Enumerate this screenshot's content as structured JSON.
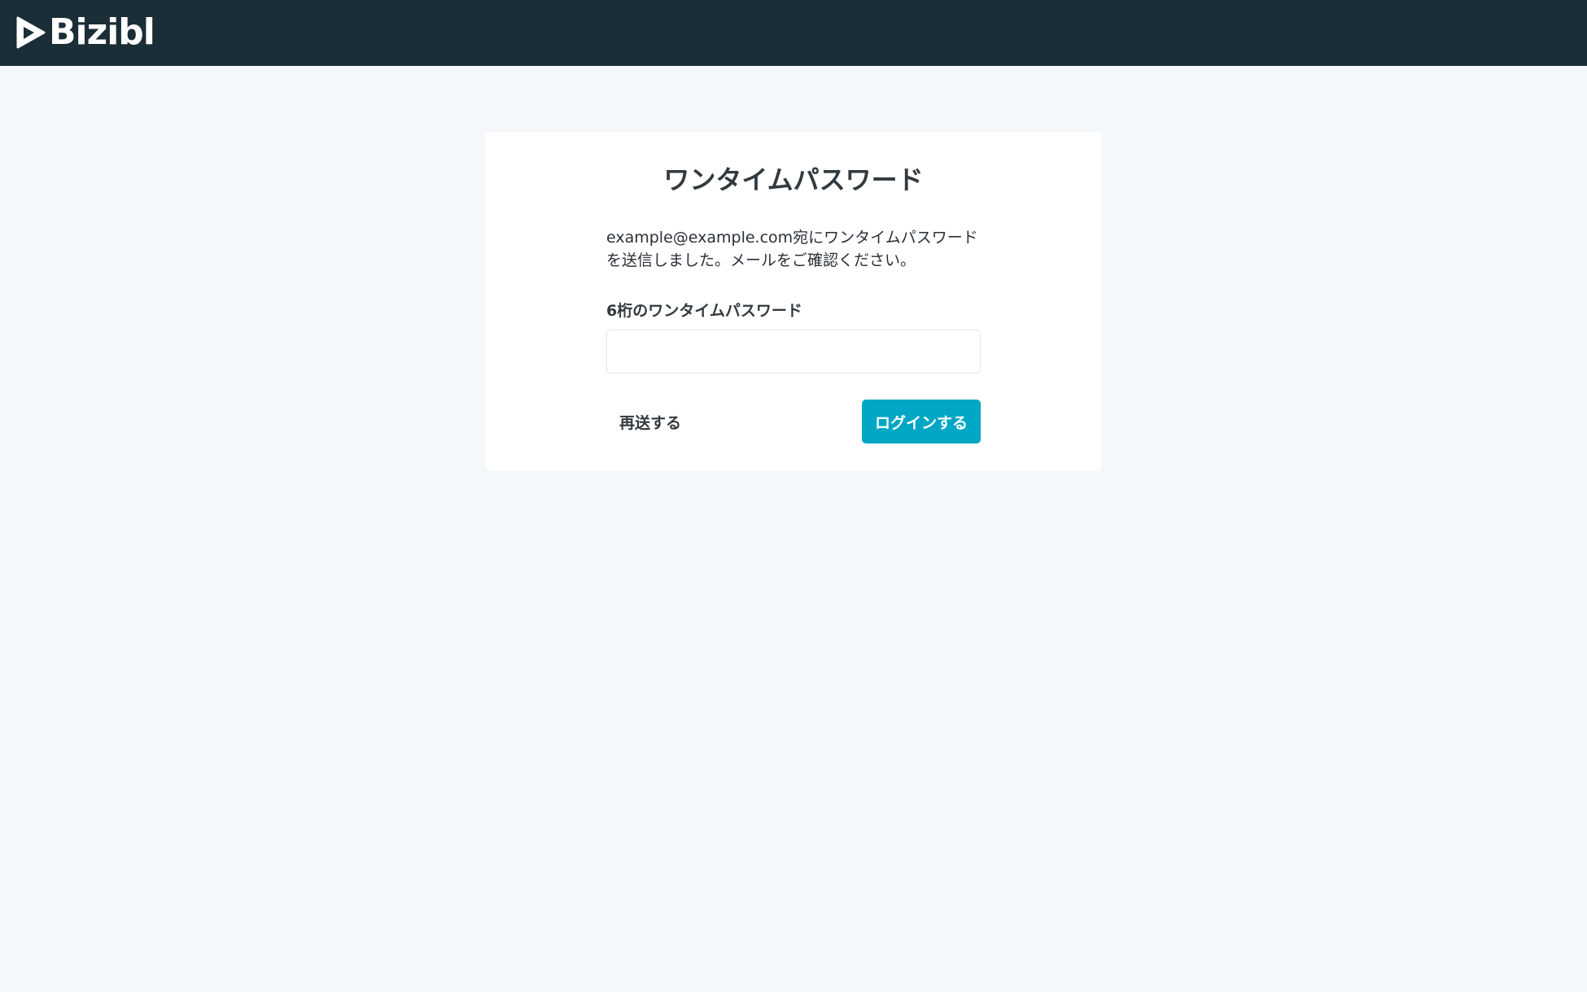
{
  "app": {
    "logo_text": "Bizibl",
    "logo_icon": "play-triangle-icon"
  },
  "card": {
    "title": "ワンタイムパスワード",
    "description": "example@example.com宛にワンタイムパスワードを送信しました。メールをご確認ください。",
    "field_label": "6桁のワンタイムパスワード",
    "input_value": "",
    "input_placeholder": "",
    "resend_label": "再送する",
    "login_label": "ログインする"
  },
  "colors": {
    "header_bg": "#1b2d36",
    "page_bg": "#f4f8fb",
    "card_bg": "#ffffff",
    "primary": "#00a7c4"
  }
}
